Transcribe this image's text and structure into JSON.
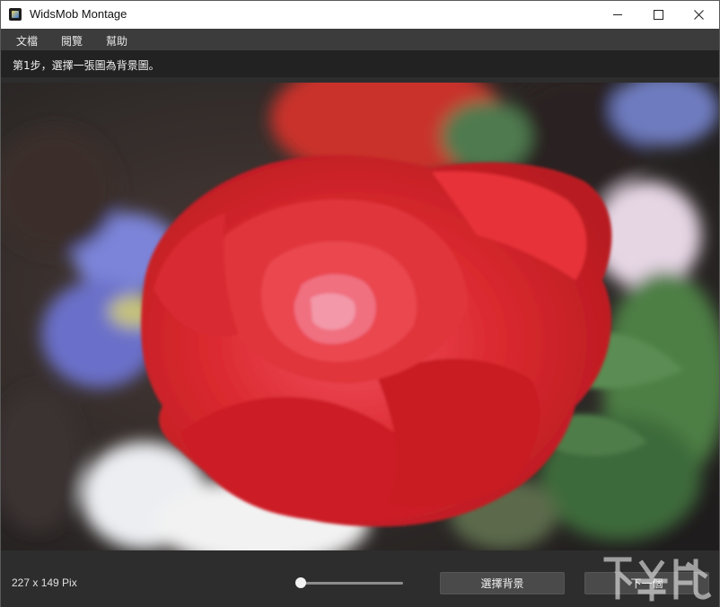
{
  "window": {
    "title": "WidsMob Montage",
    "icon": "app-logo-icon"
  },
  "menu": {
    "items": [
      {
        "label": "文檔"
      },
      {
        "label": "閱覽"
      },
      {
        "label": "幫助"
      }
    ]
  },
  "step": {
    "instruction": "第1步，選擇一張圖為背景圖。"
  },
  "status": {
    "image_size": "227 x 149 Pix"
  },
  "zoom": {
    "level": 0
  },
  "actions": {
    "select_background": "選擇背景",
    "next": "下一個"
  },
  "colors": {
    "menubar_bg": "#3c3c3c",
    "panel_bg": "#2d2d2d",
    "button_bg": "#4a4a4a",
    "rose_red": "#d8262a"
  }
}
